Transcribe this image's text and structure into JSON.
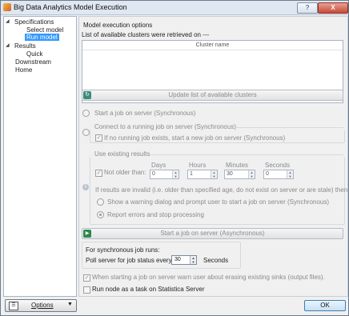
{
  "window": {
    "title": "Big Data Analytics Model Execution",
    "help_label": "?",
    "close_label": "X"
  },
  "tree": {
    "items": [
      {
        "label": "Specifications",
        "toggle": "◢"
      },
      {
        "label": "Select model"
      },
      {
        "label": "Run model",
        "selected": true
      },
      {
        "label": "Results",
        "toggle": "◢"
      },
      {
        "label": "Quick"
      },
      {
        "label": "Downstream"
      },
      {
        "label": "Home"
      }
    ]
  },
  "main": {
    "heading": "Model execution options",
    "clusters_status": "List of available clusters were retrieved on ---",
    "cluster_table_header": "Cluster name",
    "update_button": "Update list of available clusters",
    "start_sync_label": "Start a job on server (Synchronous)",
    "connect_label": "Connect to a running job on server (Synchronous)",
    "if_no_running_label": "If no running job exists, start a new job on server (Synchronous)",
    "use_existing": {
      "title": "Use existing results",
      "not_older_label": "Not older than:",
      "columns": [
        {
          "label": "Days",
          "value": "0"
        },
        {
          "label": "Hours",
          "value": "1"
        },
        {
          "label": "Minutes",
          "value": "30"
        },
        {
          "label": "Seconds",
          "value": "0"
        }
      ],
      "invalid_text": "If results are invalid (i.e. older than specified age, do not exist on server or are stale) then:",
      "show_warning_label": "Show a warning dialog and prompt user to start a job on server (Synchronous)",
      "report_errors_label": "Report errors and stop processing"
    },
    "async_button": "Start a job on server (Asynchronous)",
    "sync_runs_label": "For synchronous job runs:",
    "poll_label": "Poll server for job status every",
    "poll_value": "30",
    "poll_unit": "Seconds",
    "warn_sinks_label": "When starting a job on server warn user about erasing existing sinks (output files).",
    "run_as_task_label": "Run node as a task on Statistica Server"
  },
  "footer": {
    "options_label": "Options",
    "ok_label": "OK"
  }
}
